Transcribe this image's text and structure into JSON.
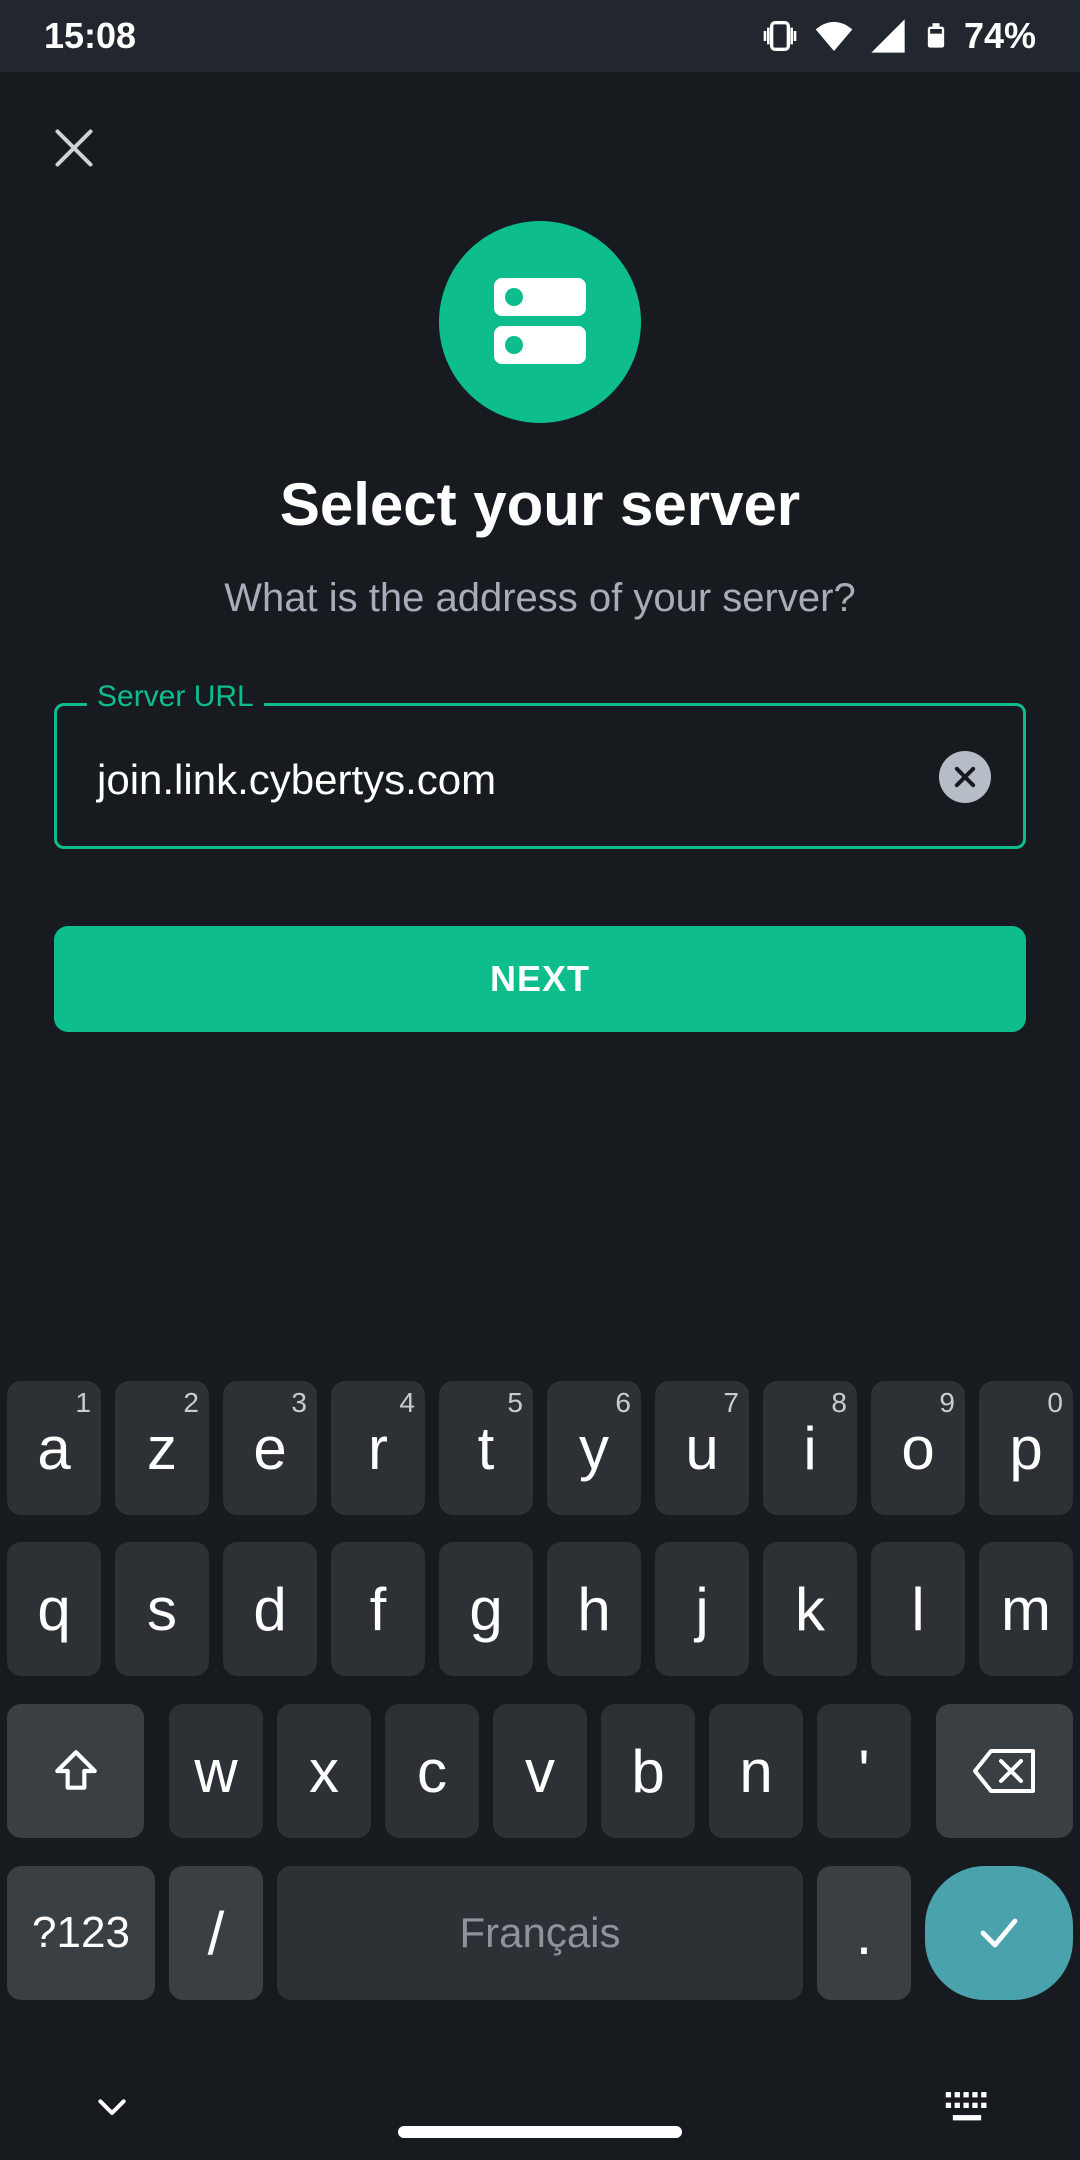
{
  "status_bar": {
    "time": "15:08",
    "battery": "74%"
  },
  "header": {
    "close_icon": "close-icon"
  },
  "logo": {
    "icon": "server-icon",
    "color": "#0dbd8b"
  },
  "content": {
    "title": "Select your server",
    "subtitle": "What is the address of your server?"
  },
  "url_field": {
    "label": "Server URL",
    "value": "join.link.cybertys.com",
    "clear_icon": "clear-icon"
  },
  "next_button": {
    "label": "NEXT"
  },
  "keyboard": {
    "row1": [
      {
        "key": "a",
        "hint": "1"
      },
      {
        "key": "z",
        "hint": "2"
      },
      {
        "key": "e",
        "hint": "3"
      },
      {
        "key": "r",
        "hint": "4"
      },
      {
        "key": "t",
        "hint": "5"
      },
      {
        "key": "y",
        "hint": "6"
      },
      {
        "key": "u",
        "hint": "7"
      },
      {
        "key": "i",
        "hint": "8"
      },
      {
        "key": "o",
        "hint": "9"
      },
      {
        "key": "p",
        "hint": "0"
      }
    ],
    "row2": [
      "q",
      "s",
      "d",
      "f",
      "g",
      "h",
      "j",
      "k",
      "l",
      "m"
    ],
    "row3": [
      "w",
      "x",
      "c",
      "v",
      "b",
      "n",
      "'"
    ],
    "symbols": "?123",
    "slash": "/",
    "space": "Français",
    "period": "."
  },
  "colors": {
    "accent": "#0dbd8b",
    "background": "#171b1f",
    "enter_key": "#4aa3ac"
  }
}
